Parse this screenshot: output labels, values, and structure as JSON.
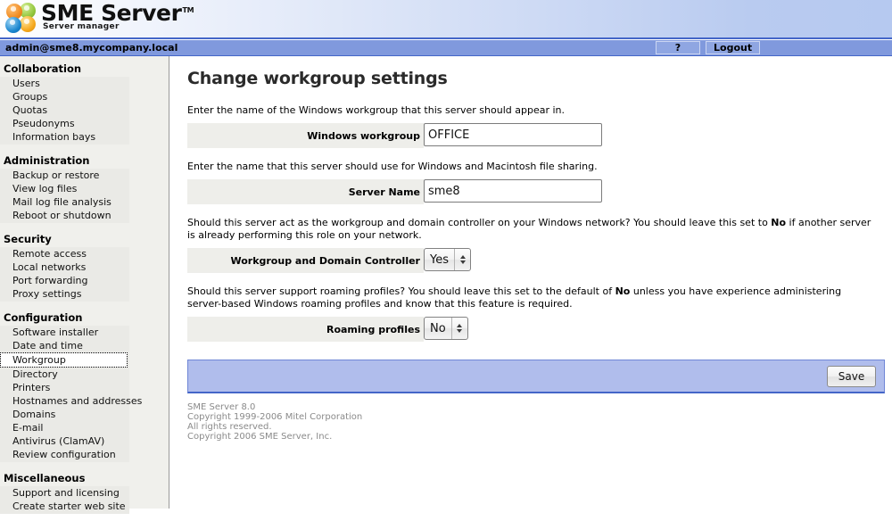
{
  "banner": {
    "product_name": "SME Server",
    "trademark": "TM",
    "subtitle": "Server manager",
    "logo_colors": {
      "orange": "#f08a20",
      "green": "#93c63c",
      "blue": "#1a86cf",
      "yellow": "#f5a81c"
    }
  },
  "adminbar": {
    "user": "admin@sme8.mycompany.local",
    "help_label": "?",
    "logout_label": "Logout",
    "background": "#8099dd"
  },
  "sidebar": {
    "sections": [
      {
        "heading": "Collaboration",
        "items": [
          {
            "label": "Users",
            "selected": false
          },
          {
            "label": "Groups",
            "selected": false
          },
          {
            "label": "Quotas",
            "selected": false
          },
          {
            "label": "Pseudonyms",
            "selected": false
          },
          {
            "label": "Information bays",
            "selected": false
          }
        ]
      },
      {
        "heading": "Administration",
        "items": [
          {
            "label": "Backup or restore",
            "selected": false
          },
          {
            "label": "View log files",
            "selected": false
          },
          {
            "label": "Mail log file analysis",
            "selected": false
          },
          {
            "label": "Reboot or shutdown",
            "selected": false
          }
        ]
      },
      {
        "heading": "Security",
        "items": [
          {
            "label": "Remote access",
            "selected": false
          },
          {
            "label": "Local networks",
            "selected": false
          },
          {
            "label": "Port forwarding",
            "selected": false
          },
          {
            "label": "Proxy settings",
            "selected": false
          }
        ]
      },
      {
        "heading": "Configuration",
        "items": [
          {
            "label": "Software installer",
            "selected": false
          },
          {
            "label": "Date and time",
            "selected": false
          },
          {
            "label": "Workgroup",
            "selected": true
          },
          {
            "label": "Directory",
            "selected": false
          },
          {
            "label": "Printers",
            "selected": false
          },
          {
            "label": "Hostnames and addresses",
            "selected": false
          },
          {
            "label": "Domains",
            "selected": false
          },
          {
            "label": "E-mail",
            "selected": false
          },
          {
            "label": "Antivirus (ClamAV)",
            "selected": false
          },
          {
            "label": "Review configuration",
            "selected": false
          }
        ]
      },
      {
        "heading": "Miscellaneous",
        "items": [
          {
            "label": "Support and licensing",
            "selected": false
          },
          {
            "label": "Create starter web site",
            "selected": false
          }
        ]
      }
    ]
  },
  "main": {
    "title": "Change workgroup settings",
    "help_workgroup": "Enter the name of the Windows workgroup that this server should appear in.",
    "help_servername": "Enter the name that this server should use for Windows and Macintosh file sharing.",
    "help_dc_part1": "Should this server act as the workgroup and domain controller on your Windows network? You should leave this set to ",
    "help_dc_bold": "No",
    "help_dc_part2": " if another server is already performing this role on your network.",
    "help_roaming_part1": "Should this server support roaming profiles? You should leave this set to the default of ",
    "help_roaming_bold": "No",
    "help_roaming_part2": " unless you have experience administering server-based Windows roaming profiles and know that this feature is required.",
    "fields": {
      "workgroup": {
        "label": "Windows workgroup",
        "value": "OFFICE"
      },
      "servername": {
        "label": "Server Name",
        "value": "sme8"
      },
      "domain_controller": {
        "label": "Workgroup and Domain Controller",
        "value": "Yes",
        "options": [
          "Yes",
          "No"
        ]
      },
      "roaming_profiles": {
        "label": "Roaming profiles",
        "value": "No",
        "options": [
          "Yes",
          "No"
        ]
      }
    },
    "save_label": "Save",
    "save_bar_color": "#b0bdec"
  },
  "footer": {
    "line1": "SME Server 8.0",
    "line2": "Copyright 1999-2006 Mitel Corporation",
    "line3": "All rights reserved.",
    "line4": "Copyright 2006 SME Server, Inc."
  }
}
